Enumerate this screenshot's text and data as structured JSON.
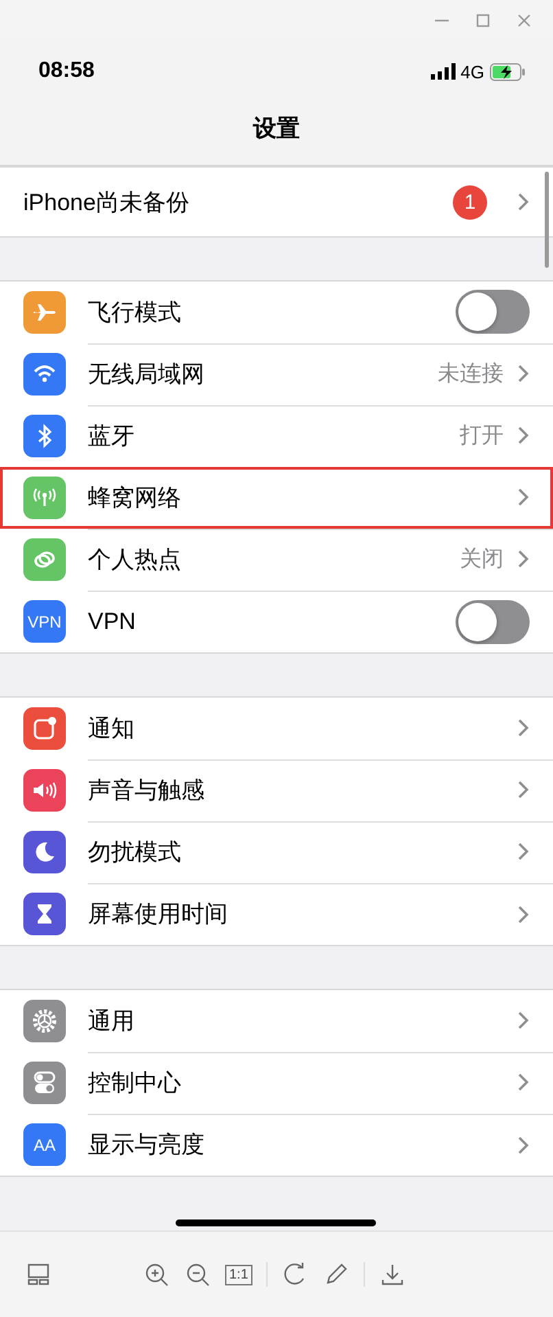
{
  "status_bar": {
    "time": "08:58",
    "network": "4G"
  },
  "nav": {
    "title": "设置"
  },
  "backup_row": {
    "label": "iPhone尚未备份",
    "badge": "1"
  },
  "sections": [
    {
      "items": [
        {
          "label": "飞行模式",
          "kind": "toggle",
          "on": false,
          "highlighted": false
        },
        {
          "label": "无线局域网",
          "kind": "value",
          "value": "未连接",
          "highlighted": false
        },
        {
          "label": "蓝牙",
          "kind": "value",
          "value": "打开",
          "highlighted": false
        },
        {
          "label": "蜂窝网络",
          "kind": "link",
          "highlighted": true
        },
        {
          "label": "个人热点",
          "kind": "value",
          "value": "关闭",
          "highlighted": false
        },
        {
          "label": "VPN",
          "kind": "toggle",
          "on": false,
          "icon_text": "VPN",
          "highlighted": false
        }
      ]
    },
    {
      "items": [
        {
          "label": "通知",
          "kind": "link",
          "highlighted": false
        },
        {
          "label": "声音与触感",
          "kind": "link",
          "highlighted": false
        },
        {
          "label": "勿扰模式",
          "kind": "link",
          "highlighted": false
        },
        {
          "label": "屏幕使用时间",
          "kind": "link",
          "highlighted": false
        }
      ]
    },
    {
      "items": [
        {
          "label": "通用",
          "kind": "link",
          "highlighted": false
        },
        {
          "label": "控制中心",
          "kind": "link",
          "highlighted": false
        },
        {
          "label": "显示与亮度",
          "kind": "link",
          "icon_text": "AA",
          "highlighted": false
        }
      ]
    }
  ],
  "toolbar": {
    "actual_size": "1:1"
  }
}
